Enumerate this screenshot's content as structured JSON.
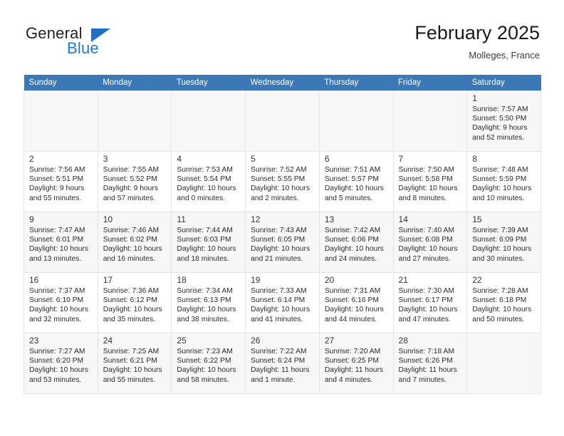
{
  "logo": {
    "word_one": "General",
    "word_two": "Blue",
    "triangle_icon": "triangle-icon",
    "accent_color": "#1f7ac4"
  },
  "header": {
    "title": "February 2025",
    "subtitle": "Molleges, France"
  },
  "calendar": {
    "header_background": "#3b78b5",
    "weekdays": [
      "Sunday",
      "Monday",
      "Tuesday",
      "Wednesday",
      "Thursday",
      "Friday",
      "Saturday"
    ],
    "weeks": [
      [
        {
          "day": "",
          "lines": []
        },
        {
          "day": "",
          "lines": []
        },
        {
          "day": "",
          "lines": []
        },
        {
          "day": "",
          "lines": []
        },
        {
          "day": "",
          "lines": []
        },
        {
          "day": "",
          "lines": []
        },
        {
          "day": "1",
          "lines": [
            "Sunrise: 7:57 AM",
            "Sunset: 5:50 PM",
            "Daylight: 9 hours",
            "and 52 minutes."
          ]
        }
      ],
      [
        {
          "day": "2",
          "lines": [
            "Sunrise: 7:56 AM",
            "Sunset: 5:51 PM",
            "Daylight: 9 hours",
            "and 55 minutes."
          ]
        },
        {
          "day": "3",
          "lines": [
            "Sunrise: 7:55 AM",
            "Sunset: 5:52 PM",
            "Daylight: 9 hours",
            "and 57 minutes."
          ]
        },
        {
          "day": "4",
          "lines": [
            "Sunrise: 7:53 AM",
            "Sunset: 5:54 PM",
            "Daylight: 10 hours",
            "and 0 minutes."
          ]
        },
        {
          "day": "5",
          "lines": [
            "Sunrise: 7:52 AM",
            "Sunset: 5:55 PM",
            "Daylight: 10 hours",
            "and 2 minutes."
          ]
        },
        {
          "day": "6",
          "lines": [
            "Sunrise: 7:51 AM",
            "Sunset: 5:57 PM",
            "Daylight: 10 hours",
            "and 5 minutes."
          ]
        },
        {
          "day": "7",
          "lines": [
            "Sunrise: 7:50 AM",
            "Sunset: 5:58 PM",
            "Daylight: 10 hours",
            "and 8 minutes."
          ]
        },
        {
          "day": "8",
          "lines": [
            "Sunrise: 7:48 AM",
            "Sunset: 5:59 PM",
            "Daylight: 10 hours",
            "and 10 minutes."
          ]
        }
      ],
      [
        {
          "day": "9",
          "lines": [
            "Sunrise: 7:47 AM",
            "Sunset: 6:01 PM",
            "Daylight: 10 hours",
            "and 13 minutes."
          ]
        },
        {
          "day": "10",
          "lines": [
            "Sunrise: 7:46 AM",
            "Sunset: 6:02 PM",
            "Daylight: 10 hours",
            "and 16 minutes."
          ]
        },
        {
          "day": "11",
          "lines": [
            "Sunrise: 7:44 AM",
            "Sunset: 6:03 PM",
            "Daylight: 10 hours",
            "and 18 minutes."
          ]
        },
        {
          "day": "12",
          "lines": [
            "Sunrise: 7:43 AM",
            "Sunset: 6:05 PM",
            "Daylight: 10 hours",
            "and 21 minutes."
          ]
        },
        {
          "day": "13",
          "lines": [
            "Sunrise: 7:42 AM",
            "Sunset: 6:06 PM",
            "Daylight: 10 hours",
            "and 24 minutes."
          ]
        },
        {
          "day": "14",
          "lines": [
            "Sunrise: 7:40 AM",
            "Sunset: 6:08 PM",
            "Daylight: 10 hours",
            "and 27 minutes."
          ]
        },
        {
          "day": "15",
          "lines": [
            "Sunrise: 7:39 AM",
            "Sunset: 6:09 PM",
            "Daylight: 10 hours",
            "and 30 minutes."
          ]
        }
      ],
      [
        {
          "day": "16",
          "lines": [
            "Sunrise: 7:37 AM",
            "Sunset: 6:10 PM",
            "Daylight: 10 hours",
            "and 32 minutes."
          ]
        },
        {
          "day": "17",
          "lines": [
            "Sunrise: 7:36 AM",
            "Sunset: 6:12 PM",
            "Daylight: 10 hours",
            "and 35 minutes."
          ]
        },
        {
          "day": "18",
          "lines": [
            "Sunrise: 7:34 AM",
            "Sunset: 6:13 PM",
            "Daylight: 10 hours",
            "and 38 minutes."
          ]
        },
        {
          "day": "19",
          "lines": [
            "Sunrise: 7:33 AM",
            "Sunset: 6:14 PM",
            "Daylight: 10 hours",
            "and 41 minutes."
          ]
        },
        {
          "day": "20",
          "lines": [
            "Sunrise: 7:31 AM",
            "Sunset: 6:16 PM",
            "Daylight: 10 hours",
            "and 44 minutes."
          ]
        },
        {
          "day": "21",
          "lines": [
            "Sunrise: 7:30 AM",
            "Sunset: 6:17 PM",
            "Daylight: 10 hours",
            "and 47 minutes."
          ]
        },
        {
          "day": "22",
          "lines": [
            "Sunrise: 7:28 AM",
            "Sunset: 6:18 PM",
            "Daylight: 10 hours",
            "and 50 minutes."
          ]
        }
      ],
      [
        {
          "day": "23",
          "lines": [
            "Sunrise: 7:27 AM",
            "Sunset: 6:20 PM",
            "Daylight: 10 hours",
            "and 53 minutes."
          ]
        },
        {
          "day": "24",
          "lines": [
            "Sunrise: 7:25 AM",
            "Sunset: 6:21 PM",
            "Daylight: 10 hours",
            "and 55 minutes."
          ]
        },
        {
          "day": "25",
          "lines": [
            "Sunrise: 7:23 AM",
            "Sunset: 6:22 PM",
            "Daylight: 10 hours",
            "and 58 minutes."
          ]
        },
        {
          "day": "26",
          "lines": [
            "Sunrise: 7:22 AM",
            "Sunset: 6:24 PM",
            "Daylight: 11 hours",
            "and 1 minute."
          ]
        },
        {
          "day": "27",
          "lines": [
            "Sunrise: 7:20 AM",
            "Sunset: 6:25 PM",
            "Daylight: 11 hours",
            "and 4 minutes."
          ]
        },
        {
          "day": "28",
          "lines": [
            "Sunrise: 7:18 AM",
            "Sunset: 6:26 PM",
            "Daylight: 11 hours",
            "and 7 minutes."
          ]
        },
        {
          "day": "",
          "lines": []
        }
      ]
    ]
  }
}
